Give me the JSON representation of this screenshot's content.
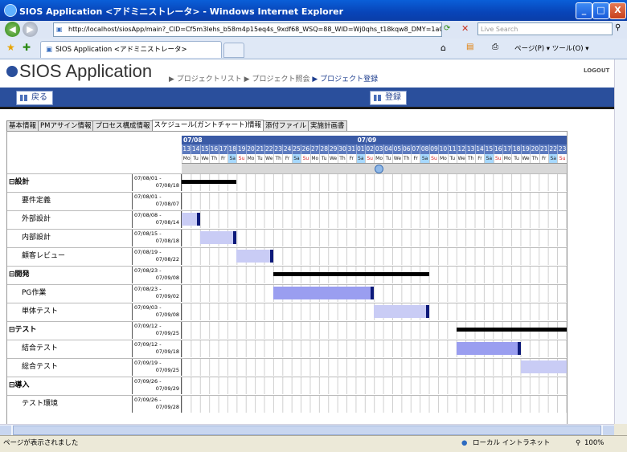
{
  "window": {
    "title": "SIOS Application <アドミニストレータ> - Windows Internet Explorer",
    "min": "_",
    "max": "□",
    "close": "X"
  },
  "browser": {
    "url": "http://localhost/siosApp/main?_CID=Cf5m3lehs_b58m4p15eq4s_9xdf68_WSQ=88_WID=Wj0qhs_t18kqw8_DMY=1aCf5r",
    "search_placeholder": "Live Search",
    "tab_title": "SIOS Application <アドミニストレータ>",
    "tools": "ページ(P) ▾  ツール(O) ▾"
  },
  "app": {
    "title": "SIOS Application",
    "breadcrumb": [
      "▶ プロジェクトリスト",
      "▶ プロジェクト照会",
      "▶ プロジェクト登録"
    ],
    "logout": "LOGOUT",
    "back_label": "戻る",
    "register_label": "登録"
  },
  "tabs": [
    "基本情報",
    "PMアサイン情報",
    "プロセス構成情報",
    "スケジュール(ガントチャート)情報",
    "添付ファイル",
    "実施計画書"
  ],
  "gantt": {
    "months": [
      {
        "label": "07/08",
        "start_index": 0
      },
      {
        "label": "07/09",
        "start_index": 19
      }
    ],
    "days": [
      "13",
      "14",
      "15",
      "16",
      "17",
      "18",
      "19",
      "20",
      "21",
      "22",
      "23",
      "24",
      "25",
      "26",
      "27",
      "28",
      "29",
      "30",
      "31",
      "01",
      "02",
      "03",
      "04",
      "05",
      "06",
      "07",
      "08",
      "09",
      "10",
      "11",
      "12",
      "13",
      "14",
      "15",
      "16",
      "17",
      "18",
      "19",
      "20",
      "21",
      "22",
      "23"
    ],
    "weekdays": [
      "Mo",
      "Tu",
      "We",
      "Th",
      "Fr",
      "Sa",
      "Su",
      "Mo",
      "Tu",
      "We",
      "Th",
      "Fr",
      "Sa",
      "Su",
      "Mo",
      "Tu",
      "We",
      "Th",
      "Fr",
      "Sa",
      "Su",
      "Mo",
      "Tu",
      "We",
      "Th",
      "Fr",
      "Sa",
      "Su",
      "Mo",
      "Tu",
      "We",
      "Th",
      "Fr",
      "Sa",
      "Su",
      "Mo",
      "Tu",
      "We",
      "Th",
      "Fr",
      "Sa",
      "Su"
    ],
    "tasks": [
      {
        "name": "⊟設計",
        "group": true,
        "start": "07/08/01 -",
        "end": "07/08/18",
        "bar_from": -1,
        "bar_to": 5,
        "kind": "sum"
      },
      {
        "name": "要件定義",
        "group": false,
        "start": "07/08/01 -",
        "end": "07/08/07",
        "kind": "none"
      },
      {
        "name": "外部設計",
        "group": false,
        "start": "07/08/08 -",
        "end": "07/08/14",
        "bar_from": -1,
        "bar_to": 1,
        "kind": "task",
        "cap": true
      },
      {
        "name": "内部設計",
        "group": false,
        "start": "07/08/15 -",
        "end": "07/08/18",
        "bar_from": 2,
        "bar_to": 5,
        "kind": "task",
        "cap": true
      },
      {
        "name": "顧客レビュー",
        "group": false,
        "start": "07/08/19 -",
        "end": "07/08/22",
        "bar_from": 6,
        "bar_to": 9,
        "kind": "task",
        "cap": true
      },
      {
        "name": "⊟開発",
        "group": true,
        "start": "07/08/23 -",
        "end": "07/09/08",
        "bar_from": 10,
        "bar_to": 26,
        "kind": "sum"
      },
      {
        "name": "PG作業",
        "group": false,
        "start": "07/08/23 -",
        "end": "07/09/02",
        "bar_from": 10,
        "bar_to": 20,
        "kind": "task",
        "cap": true,
        "active": true
      },
      {
        "name": "単体テスト",
        "group": false,
        "start": "07/09/03 -",
        "end": "07/09/08",
        "bar_from": 21,
        "bar_to": 26,
        "kind": "task",
        "cap": true
      },
      {
        "name": "⊟テスト",
        "group": true,
        "start": "07/09/12 -",
        "end": "07/09/25",
        "bar_from": 30,
        "bar_to": 41,
        "kind": "sum"
      },
      {
        "name": "結合テスト",
        "group": false,
        "start": "07/09/12 -",
        "end": "07/09/18",
        "bar_from": 30,
        "bar_to": 36,
        "kind": "task",
        "cap": true,
        "active": true
      },
      {
        "name": "総合テスト",
        "group": false,
        "start": "07/09/19 -",
        "end": "07/09/25",
        "bar_from": 37,
        "bar_to": 41,
        "kind": "task",
        "cap": false
      },
      {
        "name": "⊟導入",
        "group": true,
        "start": "07/09/26 -",
        "end": "07/09/29",
        "kind": "none"
      },
      {
        "name": "テスト環境",
        "group": false,
        "start": "07/09/26 -",
        "end": "07/09/28",
        "kind": "none"
      }
    ]
  },
  "status": {
    "text": "ページが表示されました",
    "zone": "ローカル イントラネット",
    "zoom": "100%"
  }
}
